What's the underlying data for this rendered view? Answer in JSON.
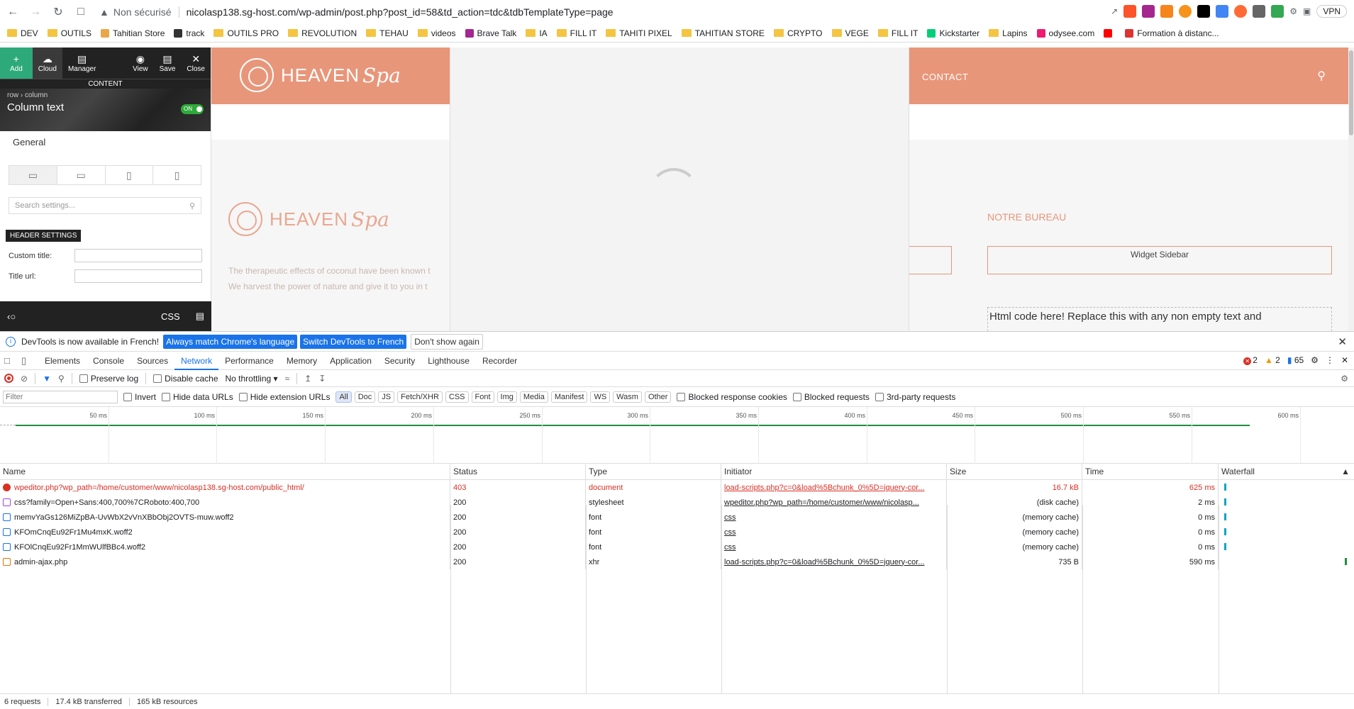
{
  "browser": {
    "insecure_label": "Non sécurisé",
    "url": "nicolasp138.sg-host.com/wp-admin/post.php?post_id=58&td_action=tdc&tdbTemplateType=page",
    "vpn_label": "VPN",
    "bookmarks": [
      "DEV",
      "OUTILS",
      "Tahitian Store",
      "track",
      "OUTILS PRO",
      "REVOLUTION",
      "TEHAU",
      "videos",
      "Brave Talk",
      "IA",
      "FILL IT",
      "TAHITI PIXEL",
      "TAHITIAN STORE",
      "CRYPTO",
      "VEGE",
      "FILL IT",
      "Kickstarter",
      "Lapins",
      "odysee.com",
      "",
      "Formation à distanc..."
    ]
  },
  "editor": {
    "toolbar": {
      "add": "Add",
      "cloud": "Cloud",
      "manager": "Manager",
      "view": "View",
      "save": "Save",
      "close": "Close"
    },
    "content_label": "CONTENT",
    "breadcrumb": "row  ›  column",
    "title": "Column text",
    "toggle": "ON",
    "tabs": [
      "General",
      "Css"
    ],
    "search_placeholder": "Search settings...",
    "header_settings": "HEADER SETTINGS",
    "custom_title_label": "Custom title:",
    "title_url_label": "Title url:",
    "bottom_css": "CSS"
  },
  "site": {
    "brand_main": "HEAVEN",
    "brand_script": "Spa",
    "nav_contact": "CONTACT",
    "para1": "The therapeutic effects of coconut have been known t",
    "para2": "We harvest the power of nature and give it to you in t",
    "notre_bureau": "NOTRE BUREAU",
    "widget_sidebar": "Widget Sidebar",
    "html_code": "Html code here! Replace this with any non empty text and"
  },
  "devtools": {
    "info": {
      "text": "DevTools is now available in French!",
      "btn1": "Always match Chrome's language",
      "btn2": "Switch DevTools to French",
      "btn3": "Don't show again"
    },
    "tabs": [
      "Elements",
      "Console",
      "Sources",
      "Network",
      "Performance",
      "Memory",
      "Application",
      "Security",
      "Lighthouse",
      "Recorder"
    ],
    "active_tab": "Network",
    "errors": "2",
    "warnings": "2",
    "messages": "65",
    "toolbar": {
      "preserve_log": "Preserve log",
      "disable_cache": "Disable cache",
      "throttle": "No throttling"
    },
    "filter": {
      "placeholder": "Filter",
      "invert": "Invert",
      "hide_data": "Hide data URLs",
      "hide_ext": "Hide extension URLs",
      "chips": [
        "All",
        "Doc",
        "JS",
        "Fetch/XHR",
        "CSS",
        "Font",
        "Img",
        "Media",
        "Manifest",
        "WS",
        "Wasm",
        "Other"
      ],
      "blocked_cookies": "Blocked response cookies",
      "blocked_requests": "Blocked requests",
      "third_party": "3rd-party requests"
    },
    "timeline_ticks": [
      "50 ms",
      "100 ms",
      "150 ms",
      "200 ms",
      "250 ms",
      "300 ms",
      "350 ms",
      "400 ms",
      "450 ms",
      "500 ms",
      "550 ms",
      "600 ms",
      "650"
    ],
    "columns": {
      "name": "Name",
      "status": "Status",
      "type": "Type",
      "initiator": "Initiator",
      "size": "Size",
      "time": "Time",
      "waterfall": "Waterfall"
    },
    "requests": [
      {
        "name": "wpeditor.php?wp_path=/home/customer/www/nicolasp138.sg-host.com/public_html/",
        "status": "403",
        "type": "document",
        "initiator": "load-scripts.php?c=0&load%5Bchunk_0%5D=jquery-cor...",
        "size": "16.7 kB",
        "time": "625 ms",
        "error": true,
        "icon": "err",
        "wb_start": 0.01,
        "wb_color": "#0aa5c2"
      },
      {
        "name": "css?family=Open+Sans:400,700%7CRoboto:400,700",
        "status": "200",
        "type": "stylesheet",
        "initiator": "wpeditor.php?wp_path=/home/customer/www/nicolasp...",
        "size": "(disk cache)",
        "time": "2 ms",
        "icon": "css",
        "wb_start": 0.01,
        "wb_color": "#0aa5c2"
      },
      {
        "name": "memvYaGs126MiZpBA-UvWbX2vVnXBbObj2OVTS-muw.woff2",
        "status": "200",
        "type": "font",
        "initiator": "css",
        "size": "(memory cache)",
        "time": "0 ms",
        "icon": "font",
        "wb_start": 0.01,
        "wb_color": "#0aa5c2"
      },
      {
        "name": "KFOmCnqEu92Fr1Mu4mxK.woff2",
        "status": "200",
        "type": "font",
        "initiator": "css",
        "size": "(memory cache)",
        "time": "0 ms",
        "icon": "font",
        "wb_start": 0.01,
        "wb_color": "#0aa5c2"
      },
      {
        "name": "KFOlCnqEu92Fr1MmWUlfBBc4.woff2",
        "status": "200",
        "type": "font",
        "initiator": "css",
        "size": "(memory cache)",
        "time": "0 ms",
        "icon": "font",
        "wb_start": 0.01,
        "wb_color": "#0aa5c2"
      },
      {
        "name": "admin-ajax.php",
        "status": "200",
        "type": "xhr",
        "initiator": "load-scripts.php?c=0&load%5Bchunk_0%5D=jquery-cor...",
        "size": "735 B",
        "time": "590 ms",
        "icon": "xhr",
        "wb_start": 0.96,
        "wb_color": "#1e8e3e"
      }
    ],
    "status": {
      "requests": "6 requests",
      "transferred": "17.4 kB transferred",
      "resources": "165 kB resources"
    }
  },
  "colors": {
    "brand": "#e8967a",
    "accent": "#1a73e8",
    "error": "#d93025"
  }
}
